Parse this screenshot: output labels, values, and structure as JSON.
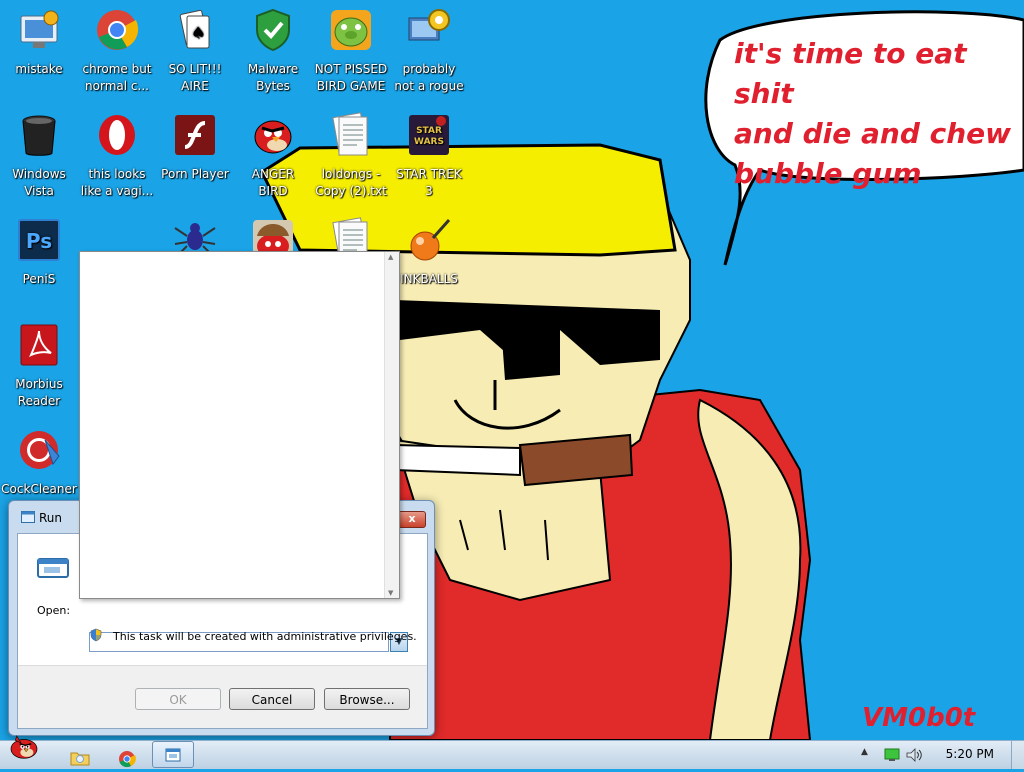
{
  "desktop": {
    "icons": [
      {
        "id": "mistake",
        "label": "mistake",
        "icon": "control-panel-icon"
      },
      {
        "id": "chrome",
        "label": "chrome but\nnormal c...",
        "icon": "chrome-icon"
      },
      {
        "id": "solit",
        "label": "SO LIT!!!\nAIRE",
        "icon": "solitaire-icon"
      },
      {
        "id": "malware",
        "label": "Malware\nBytes",
        "icon": "shield-check-icon"
      },
      {
        "id": "notpissed",
        "label": "NOT PISSED\nBIRD GAME",
        "icon": "green-pig-icon"
      },
      {
        "id": "rogue",
        "label": "probably\nnot a rogue",
        "icon": "gear-computer-icon"
      },
      {
        "id": "vista",
        "label": "Windows\nVista",
        "icon": "trash-can-icon"
      },
      {
        "id": "opera",
        "label": "this looks\nlike a vagi...",
        "icon": "opera-icon"
      },
      {
        "id": "porn",
        "label": "Porn Player",
        "icon": "flash-icon"
      },
      {
        "id": "anger",
        "label": "ANGER\nBIRD",
        "icon": "angry-bird-icon"
      },
      {
        "id": "loldongs",
        "label": "loldongs -\nCopy (2).txt",
        "icon": "text-file-icon"
      },
      {
        "id": "startrek",
        "label": "STAR TREK\n3",
        "icon": "star-trek-icon"
      },
      {
        "id": "penis",
        "label": "PeniS",
        "icon": "photoshop-icon"
      },
      {
        "id": "spider",
        "label": "",
        "icon": "spider-icon"
      },
      {
        "id": "angerbird2",
        "label": "",
        "icon": "angry-bird-hat-icon"
      },
      {
        "id": "txt2",
        "label": "",
        "icon": "text-file-icon"
      },
      {
        "id": "inkballs",
        "label": "INKBALLS",
        "icon": "inkball-icon"
      },
      {
        "id": "morbius",
        "label": "Morbius\nReader",
        "icon": "pdf-reader-icon"
      },
      {
        "id": "cock",
        "label": "CockCleaner",
        "icon": "ccleaner-icon"
      }
    ]
  },
  "wallpaper": {
    "speech_text": "it's time to eat shit\nand die and chew\nbubble gum",
    "signature": "VM0b0t",
    "colors": {
      "sky": "#1aa3e6",
      "hat": "#f5ee00",
      "skin": "#f7ecb4",
      "shirt": "#e12a2a",
      "text": "#e0202e"
    }
  },
  "run_dialog": {
    "title": "Run",
    "open_label": "Open:",
    "open_value": "",
    "admin_note": "This task will be created with administrative privileges.",
    "ok_label": "OK",
    "cancel_label": "Cancel",
    "browse_label": "Browse...",
    "close_label": "x"
  },
  "taskbar": {
    "clock": "5:20 PM",
    "pinned": [
      "angry-bird-start-icon",
      "explorer-folder-icon",
      "chrome-icon",
      "run-window-icon"
    ]
  }
}
